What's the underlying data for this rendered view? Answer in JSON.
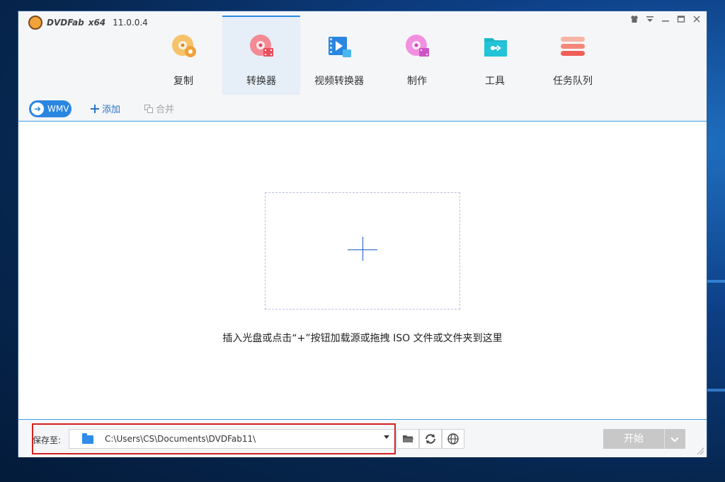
{
  "app": {
    "brand": "DVDFab",
    "arch": "x64",
    "version": "11.0.0.4"
  },
  "window_controls": [
    "shirt-icon",
    "menu-icon",
    "minimize-icon",
    "maximize-icon",
    "close-icon"
  ],
  "nav": {
    "items": [
      {
        "label": "复制",
        "icon": "copy-disc-icon",
        "active": false
      },
      {
        "label": "转换器",
        "icon": "converter-disc-icon",
        "active": true
      },
      {
        "label": "视频转换器",
        "icon": "video-converter-icon",
        "active": false
      },
      {
        "label": "制作",
        "icon": "creator-disc-icon",
        "active": false
      },
      {
        "label": "工具",
        "icon": "tools-folder-icon",
        "active": false
      },
      {
        "label": "任务队列",
        "icon": "task-queue-icon",
        "active": false
      }
    ]
  },
  "toolbar": {
    "profile": "WMV",
    "add_label": "添加",
    "merge_label": "合并"
  },
  "main": {
    "hint": "插入光盘或点击“+”按钮加载源或拖拽 ISO 文件或文件夹到这里"
  },
  "bottom": {
    "save_label": "保存至:",
    "path": "C:\\Users\\CS\\Documents\\DVDFab11\\",
    "start_label": "开始"
  },
  "colors": {
    "accent": "#2a86e0",
    "highlight": "#d42020",
    "start_disabled": "#c8c8c8"
  }
}
